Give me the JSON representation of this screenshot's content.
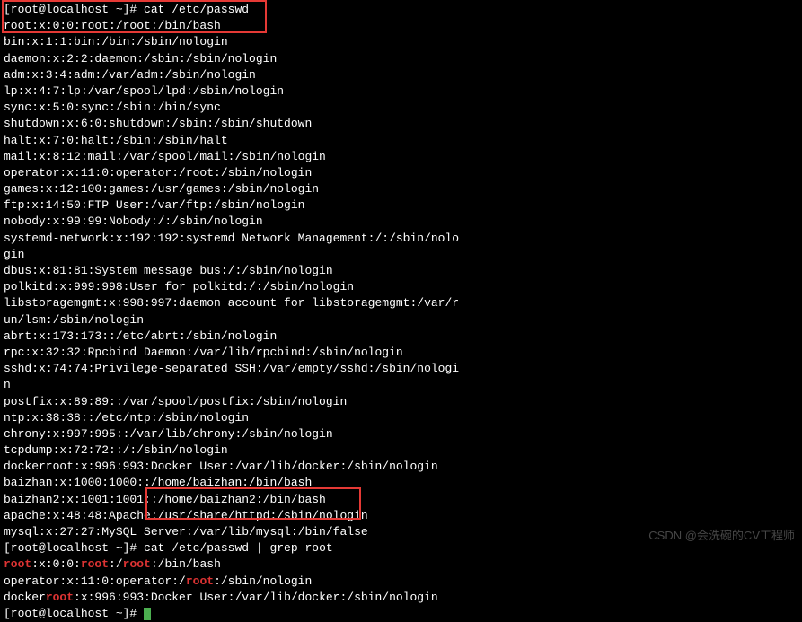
{
  "box1": {
    "prompt": "[root@localhost ~]#",
    "cmd": " cat /etc/passwd",
    "line2": "root:x:0:0:root:/root:/bin/bash"
  },
  "body_lines": [
    "bin:x:1:1:bin:/bin:/sbin/nologin",
    "daemon:x:2:2:daemon:/sbin:/sbin/nologin",
    "adm:x:3:4:adm:/var/adm:/sbin/nologin",
    "lp:x:4:7:lp:/var/spool/lpd:/sbin/nologin",
    "sync:x:5:0:sync:/sbin:/bin/sync",
    "shutdown:x:6:0:shutdown:/sbin:/sbin/shutdown",
    "halt:x:7:0:halt:/sbin:/sbin/halt",
    "mail:x:8:12:mail:/var/spool/mail:/sbin/nologin",
    "operator:x:11:0:operator:/root:/sbin/nologin",
    "games:x:12:100:games:/usr/games:/sbin/nologin",
    "ftp:x:14:50:FTP User:/var/ftp:/sbin/nologin",
    "nobody:x:99:99:Nobody:/:/sbin/nologin",
    "systemd-network:x:192:192:systemd Network Management:/:/sbin/nolo",
    "gin",
    "dbus:x:81:81:System message bus:/:/sbin/nologin",
    "polkitd:x:999:998:User for polkitd:/:/sbin/nologin",
    "libstoragemgmt:x:998:997:daemon account for libstoragemgmt:/var/r",
    "un/lsm:/sbin/nologin",
    "abrt:x:173:173::/etc/abrt:/sbin/nologin",
    "rpc:x:32:32:Rpcbind Daemon:/var/lib/rpcbind:/sbin/nologin",
    "sshd:x:74:74:Privilege-separated SSH:/var/empty/sshd:/sbin/nologi",
    "n",
    "postfix:x:89:89::/var/spool/postfix:/sbin/nologin",
    "ntp:x:38:38::/etc/ntp:/sbin/nologin",
    "chrony:x:997:995::/var/lib/chrony:/sbin/nologin",
    "tcpdump:x:72:72::/:/sbin/nologin",
    "dockerroot:x:996:993:Docker User:/var/lib/docker:/sbin/nologin",
    "baizhan:x:1000:1000::/home/baizhan:/bin/bash",
    "baizhan2:x:1001:1001::/home/baizhan2:/bin/bash",
    "apache:x:48:48:Apache:/usr/share/httpd:/sbin/nologin"
  ],
  "box2": {
    "line1": "mysql:x:27:27:MySQL Server:/var/lib/mysql:/bin/false",
    "prompt": "[root@localhost ~]#",
    "cmd": " cat /etc/passwd | grep root"
  },
  "grep_results": [
    {
      "pre": "",
      "hl": "root",
      "mid": ":x:0:0:",
      "hl2": "root",
      "mid2": ":/",
      "hl3": "root",
      "post": ":/bin/bash"
    },
    {
      "pre": "operator:x:11:0:operator:/",
      "hl": "root",
      "post": ":/sbin/nologin"
    },
    {
      "pre": "docker",
      "hl": "root",
      "post": ":x:996:993:Docker User:/var/lib/docker:/sbin/nologin"
    }
  ],
  "final_prompt": "[root@localhost ~]# ",
  "watermark": "CSDN @会洗碗的CV工程师"
}
